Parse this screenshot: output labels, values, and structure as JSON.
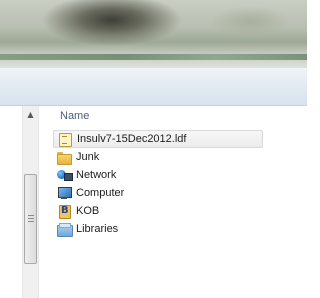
{
  "header": {
    "column_name": "Name"
  },
  "scrollbar": {
    "up_arrow": "▲",
    "grip": "≡"
  },
  "list": {
    "items": [
      {
        "label": "Insulv7-15Dec2012.ldf",
        "icon": "document-icon",
        "selected": true
      },
      {
        "label": "Junk",
        "icon": "folder-icon",
        "selected": false
      },
      {
        "label": "Network",
        "icon": "network-icon",
        "selected": false
      },
      {
        "label": "Computer",
        "icon": "computer-icon",
        "selected": false
      },
      {
        "label": "KOB",
        "icon": "user-folder-icon",
        "selected": false
      },
      {
        "label": "Libraries",
        "icon": "libraries-icon",
        "selected": false
      }
    ]
  },
  "colors": {
    "header_text": "#4c607a",
    "selection_bg": "#ececec",
    "chrome_glass": "#dfe7f0"
  }
}
